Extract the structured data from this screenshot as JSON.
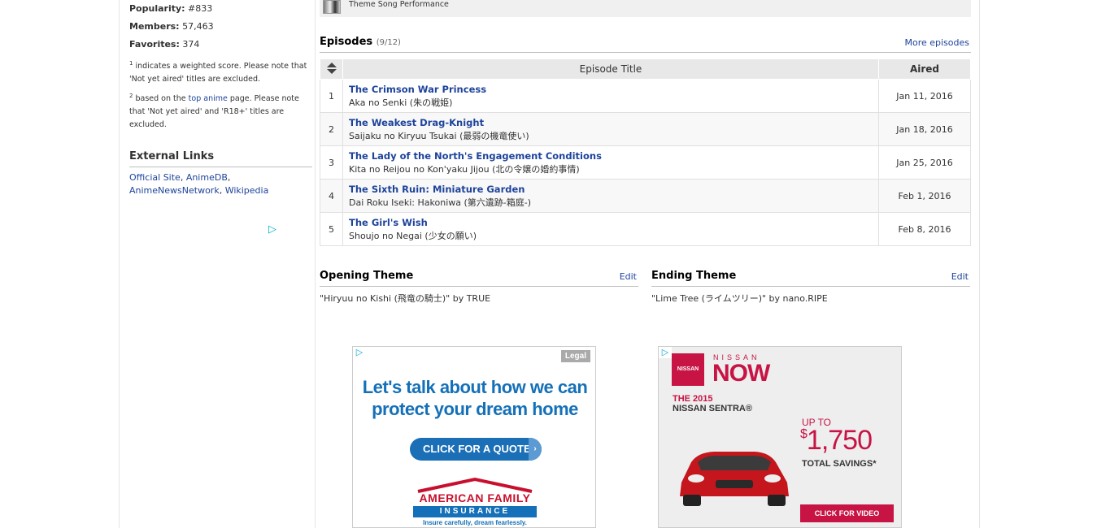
{
  "stats": {
    "popularity_label": "Popularity:",
    "popularity_value": "#833",
    "members_label": "Members:",
    "members_value": "57,463",
    "favorites_label": "Favorites:",
    "favorites_value": "374"
  },
  "notes": {
    "note1_sup": "1",
    "note1_text": " indicates a weighted score. Please note that 'Not yet aired' titles are excluded.",
    "note2_sup": "2",
    "note2_pre": " based on the ",
    "note2_link": "top anime",
    "note2_post": " page. Please note that 'Not yet aired' and 'R18+' titles are excluded."
  },
  "external_links": {
    "heading": "External Links",
    "links": [
      "Official Site",
      "AnimeDB",
      "AnimeNewsNetwork",
      "Wikipedia"
    ]
  },
  "top_strip": {
    "text": "Theme Song Performance"
  },
  "episodes": {
    "heading": "Episodes",
    "count": "(9/12)",
    "more_link": "More episodes",
    "col_title": "Episode Title",
    "col_aired": "Aired",
    "rows": [
      {
        "num": "1",
        "title": "The Crimson War Princess",
        "alt": "Aka no Senki (朱の戦姫)",
        "aired": "Jan 11, 2016"
      },
      {
        "num": "2",
        "title": "The Weakest Drag-Knight",
        "alt": "Saijaku no Kiryuu Tsukai (最弱の機竜使い)",
        "aired": "Jan 18, 2016"
      },
      {
        "num": "3",
        "title": "The Lady of the North's Engagement Conditions",
        "alt": "Kita no Reijou no Kon'yaku Jijou (北の令嬢の婚約事情)",
        "aired": "Jan 25, 2016"
      },
      {
        "num": "4",
        "title": "The Sixth Ruin: Miniature Garden",
        "alt": "Dai Roku Iseki: Hakoniwa (第六遺跡-箱庭-)",
        "aired": "Feb 1, 2016"
      },
      {
        "num": "5",
        "title": "The Girl's Wish",
        "alt": "Shoujo no Negai (少女の願い)",
        "aired": "Feb 8, 2016"
      }
    ]
  },
  "opening": {
    "heading": "Opening Theme",
    "edit": "Edit",
    "song": "\"Hiryuu no Kishi (飛竜の騎士)\" by TRUE"
  },
  "ending": {
    "heading": "Ending Theme",
    "edit": "Edit",
    "song": "\"Lime Tree (ライムツリー)\" by nano.RIPE"
  },
  "ad_af": {
    "legal": "Legal",
    "headline_1": "Let's talk about how we can",
    "headline_2": "protect your dream home",
    "button": "CLICK FOR A QUOTE",
    "logo_1": "AMERICAN FAMILY",
    "logo_2": "INSURANCE",
    "tagline": "Insure carefully, dream fearlessly."
  },
  "ad_nissan": {
    "badge": "NISSAN",
    "brand": "NISSAN",
    "now": "NOW",
    "the": "THE 2015",
    "model": "NISSAN SENTRA®",
    "upto": "UP TO",
    "dollar": "$",
    "amount": "1,750",
    "savings": "TOTAL SAVINGS*",
    "button": "CLICK FOR VIDEO"
  },
  "colors": {
    "link": "#1d439b",
    "header_bg": "#e8e8e8",
    "nissan_red": "#c71444",
    "af_blue": "#1470b8"
  }
}
